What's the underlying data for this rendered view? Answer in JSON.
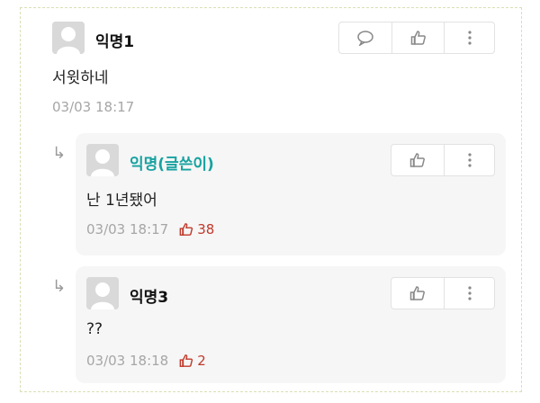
{
  "comments": [
    {
      "author": "익명1",
      "text": "서윗하네",
      "timestamp": "03/03 18:17",
      "actions": [
        "comment-icon",
        "thumbs-up-icon",
        "more-vertical-icon"
      ]
    }
  ],
  "replies": [
    {
      "author": "익명(글쓴이)",
      "author_color": "#17a2a0",
      "text": "난 1년됐어",
      "timestamp": "03/03 18:17",
      "likes": "38",
      "actions": [
        "thumbs-up-icon",
        "more-vertical-icon"
      ]
    },
    {
      "author": "익명3",
      "author_color": "#111111",
      "text": "??",
      "timestamp": "03/03 18:18",
      "likes": "2",
      "actions": [
        "thumbs-up-icon",
        "more-vertical-icon"
      ]
    }
  ],
  "colors": {
    "like": "#c0392b",
    "op_name": "#17a2a0",
    "meta": "#a6a6a6"
  }
}
